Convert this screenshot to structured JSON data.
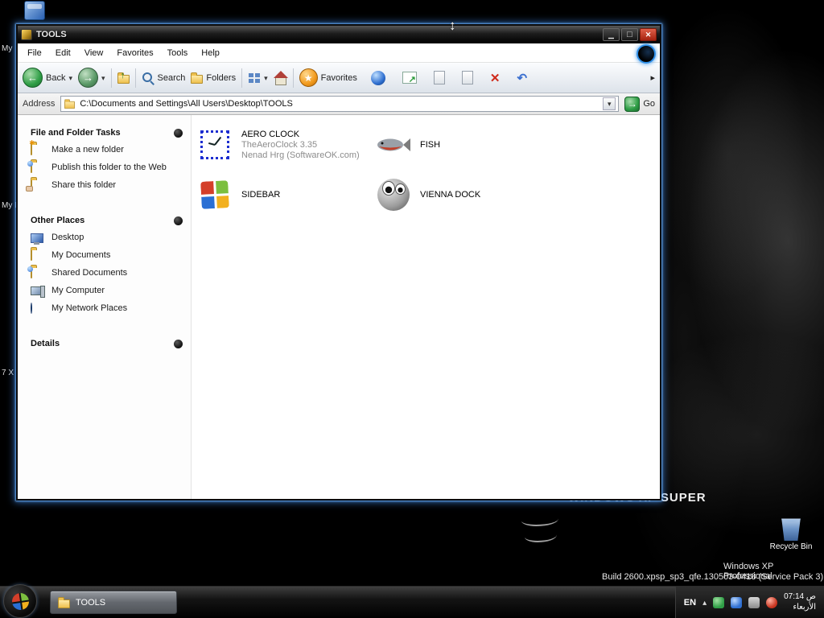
{
  "desktop": {
    "watermark": "WINDOWS XP SUPER",
    "os_name": "Windows XP Professional",
    "build_text": "Build 2600.xpsp_sp3_qfe.130503-0418 (Service Pack 3)",
    "recycle_bin_label": "Recycle Bin",
    "icon_fragments": [
      "My",
      "My D",
      "7 X"
    ]
  },
  "window": {
    "title": "TOOLS",
    "menu": [
      "File",
      "Edit",
      "View",
      "Favorites",
      "Tools",
      "Help"
    ],
    "toolbar": {
      "back_label": "Back",
      "search_label": "Search",
      "folders_label": "Folders",
      "favorites_label": "Favorites"
    },
    "address_bar": {
      "label": "Address",
      "path": "C:\\Documents and Settings\\All Users\\Desktop\\TOOLS",
      "go_label": "Go"
    }
  },
  "task_pane": {
    "file_tasks": {
      "title": "File and Folder Tasks",
      "items": [
        "Make a new folder",
        "Publish this folder to the Web",
        "Share this folder"
      ]
    },
    "other_places": {
      "title": "Other Places",
      "items": [
        "Desktop",
        "My Documents",
        "Shared Documents",
        "My Computer",
        "My Network Places"
      ]
    },
    "details": {
      "title": "Details"
    }
  },
  "files": [
    {
      "name": "AERO CLOCK",
      "detail1": "TheAeroClock 3.35",
      "detail2": "Nenad Hrg (SoftwareOK.com)"
    },
    {
      "name": "FISH"
    },
    {
      "name": "SIDEBAR"
    },
    {
      "name": "VIENNA DOCK"
    }
  ],
  "taskbar": {
    "task_button_label": "TOOLS",
    "tray": {
      "language": "EN",
      "time": "07:14 ص",
      "date": "الأربعاء"
    }
  }
}
